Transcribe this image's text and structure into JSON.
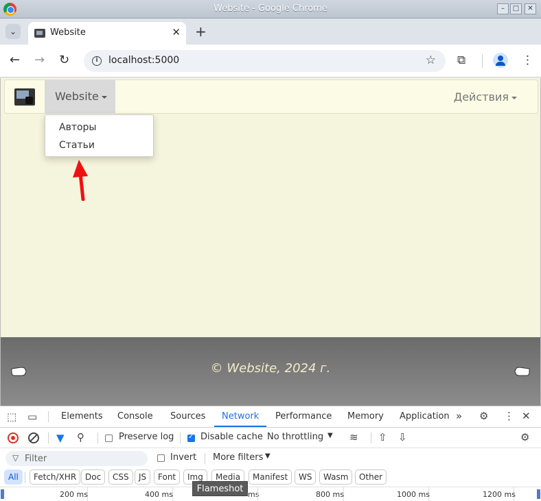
{
  "window": {
    "title": "Website - Google Chrome"
  },
  "tabs": [
    {
      "title": "Website"
    }
  ],
  "toolbar": {
    "url": "localhost:5000"
  },
  "page": {
    "brand": "Website",
    "actions": "Действия",
    "dropdown": {
      "items": [
        "Авторы",
        "Статьи"
      ]
    },
    "footer": "© Website, 2024 г."
  },
  "devtools": {
    "tabs": [
      "Elements",
      "Console",
      "Sources",
      "Network",
      "Performance",
      "Memory",
      "Application"
    ],
    "active_tab": "Network",
    "preserve_log": "Preserve log",
    "disable_cache": "Disable cache",
    "throttling": "No throttling",
    "filter_placeholder": "Filter",
    "invert": "Invert",
    "more_filters": "More filters",
    "type_filters": [
      "All",
      "Fetch/XHR",
      "Doc",
      "CSS",
      "JS",
      "Font",
      "Img",
      "Media",
      "Manifest",
      "WS",
      "Wasm",
      "Other"
    ],
    "timeline_ticks": [
      "200 ms",
      "400 ms",
      "ms",
      "800 ms",
      "1000 ms",
      "1200 ms"
    ],
    "overlay_label": "Flameshot"
  },
  "colors": {
    "page_bg": "#f5f4dc",
    "accent": "#1a73e8",
    "arrow": "#ee1111"
  }
}
